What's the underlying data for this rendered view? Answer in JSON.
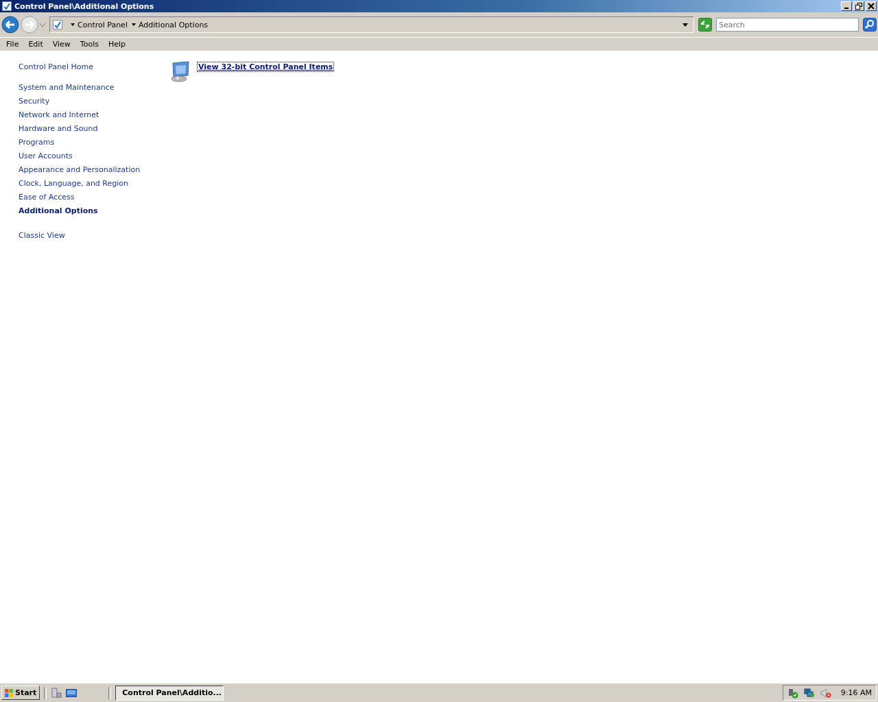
{
  "window": {
    "title": "Control Panel\\Additional Options"
  },
  "address_bar": {
    "crumbs": [
      "Control Panel",
      "Additional Options"
    ]
  },
  "search": {
    "placeholder": "Search"
  },
  "menu": [
    "File",
    "Edit",
    "View",
    "Tools",
    "Help"
  ],
  "sidebar": {
    "items": [
      {
        "label": "Control Panel Home",
        "kind": "home",
        "selected": false
      },
      {
        "label": "System and Maintenance",
        "kind": "category",
        "selected": false
      },
      {
        "label": "Security",
        "kind": "category",
        "selected": false
      },
      {
        "label": "Network and Internet",
        "kind": "category",
        "selected": false
      },
      {
        "label": "Hardware and Sound",
        "kind": "category",
        "selected": false
      },
      {
        "label": "Programs",
        "kind": "category",
        "selected": false
      },
      {
        "label": "User Accounts",
        "kind": "category",
        "selected": false
      },
      {
        "label": "Appearance and Personalization",
        "kind": "category",
        "selected": false
      },
      {
        "label": "Clock, Language, and Region",
        "kind": "category",
        "selected": false
      },
      {
        "label": "Ease of Access",
        "kind": "category",
        "selected": false
      },
      {
        "label": "Additional Options",
        "kind": "category",
        "selected": true
      },
      {
        "label": "Classic View",
        "kind": "view",
        "selected": false
      }
    ]
  },
  "content": {
    "items": [
      {
        "label": "View 32-bit Control Panel Items"
      }
    ]
  },
  "taskbar": {
    "start": "Start",
    "tasks": [
      {
        "label": "Control Panel\\Additio...",
        "selected": true
      }
    ],
    "clock": "9:16 AM"
  }
}
